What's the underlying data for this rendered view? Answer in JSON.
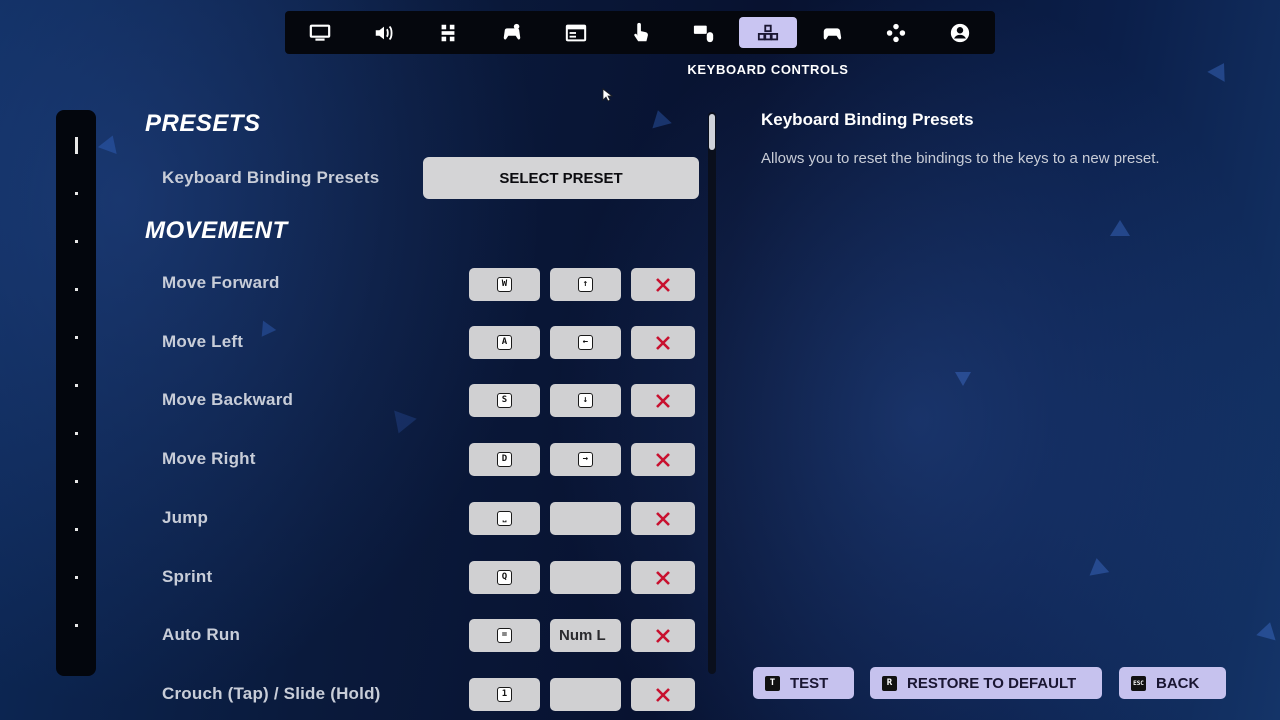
{
  "tabs": [
    {
      "id": "display",
      "icon": "monitor-icon",
      "active": false
    },
    {
      "id": "audio",
      "icon": "speaker-icon",
      "active": false
    },
    {
      "id": "accessibility",
      "icon": "grid-icon",
      "active": false
    },
    {
      "id": "controller-settings",
      "icon": "gamepad-settings-icon",
      "active": false
    },
    {
      "id": "window",
      "icon": "window-icon",
      "active": false
    },
    {
      "id": "touch",
      "icon": "touch-icon",
      "active": false
    },
    {
      "id": "mouse-keyboard",
      "icon": "keyboard-mouse-icon",
      "active": false
    },
    {
      "id": "keyboard-controls",
      "icon": "keyboard-controls-icon",
      "active": true
    },
    {
      "id": "controller",
      "icon": "controller-icon",
      "active": false
    },
    {
      "id": "controller-bindings",
      "icon": "dpad-icon",
      "active": false
    },
    {
      "id": "account",
      "icon": "account-icon",
      "active": false
    }
  ],
  "tab_caption": "KEYBOARD CONTROLS",
  "sections": {
    "presets": "PRESETS",
    "movement": "MOVEMENT"
  },
  "preset_row": {
    "label": "Keyboard Binding Presets",
    "button": "SELECT PRESET"
  },
  "bindings": [
    {
      "label": "Move Forward",
      "primary": "W",
      "secondary": "↑"
    },
    {
      "label": "Move Left",
      "primary": "A",
      "secondary": "←"
    },
    {
      "label": "Move Backward",
      "primary": "S",
      "secondary": "↓"
    },
    {
      "label": "Move Right",
      "primary": "D",
      "secondary": "→"
    },
    {
      "label": "Jump",
      "primary": "⎵",
      "secondary": ""
    },
    {
      "label": "Sprint",
      "primary": "Q",
      "secondary": ""
    },
    {
      "label": "Auto Run",
      "primary": "=",
      "secondary": "Num L"
    },
    {
      "label": "Crouch (Tap) / Slide (Hold)",
      "primary": "1",
      "secondary": ""
    }
  ],
  "details": {
    "title": "Keyboard Binding Presets",
    "description": "Allows you to reset the bindings to the keys to a new preset."
  },
  "footer": {
    "test": {
      "key": "T",
      "label": "TEST"
    },
    "restore": {
      "key": "R",
      "label": "RESTORE TO DEFAULT"
    },
    "back": {
      "key": "ESC",
      "label": "BACK"
    }
  },
  "colors": {
    "active_tab": "#c9c5f2",
    "clear_x": "#c8102e",
    "footer_button": "#c6c2ee",
    "key_button": "#d0d0d2"
  }
}
